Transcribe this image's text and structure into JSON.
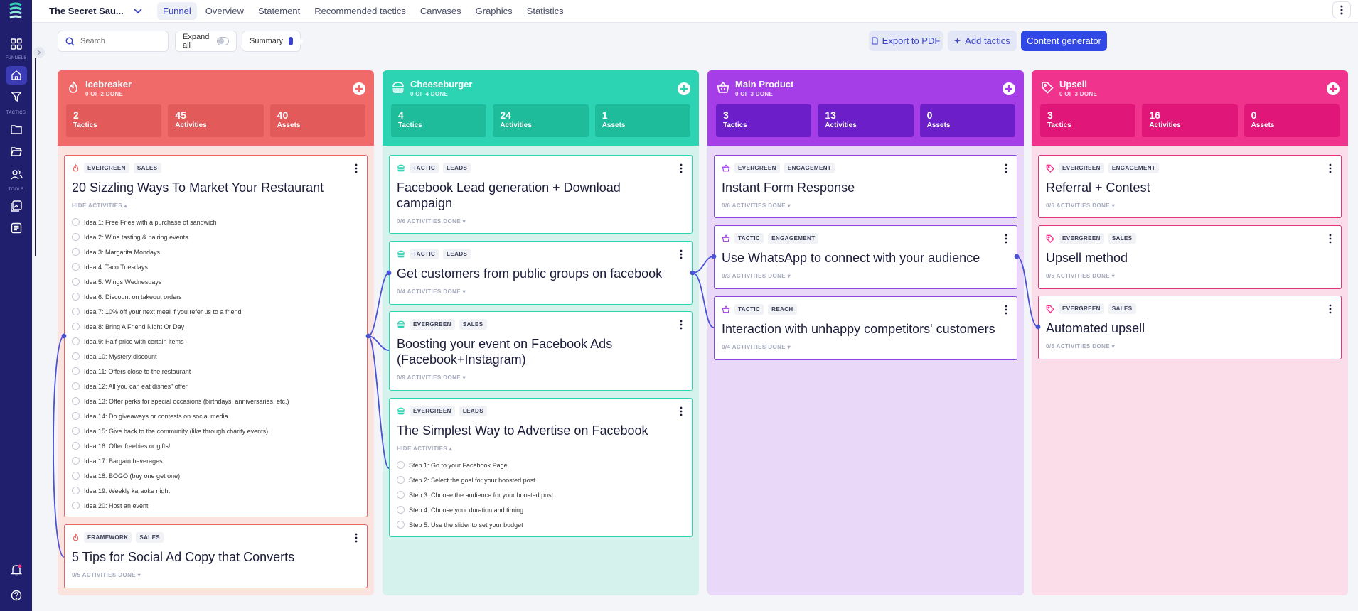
{
  "sidebar": {
    "label_funnels": "FUNNELS",
    "label_tactics": "TACTICS",
    "label_tools": "TOOLS",
    "items": [
      {
        "icon": "grid-icon"
      },
      {
        "icon": "home-icon"
      },
      {
        "icon": "filter-icon"
      },
      {
        "icon": "folder-icon"
      },
      {
        "icon": "folder-open-icon"
      },
      {
        "icon": "users-icon"
      },
      {
        "icon": "image-icon"
      },
      {
        "icon": "document-icon"
      },
      {
        "icon": "bell-icon"
      },
      {
        "icon": "help-icon"
      }
    ]
  },
  "header": {
    "project_name": "The Secret Sau...",
    "tabs": [
      "Funnel",
      "Overview",
      "Statement",
      "Recommended tactics",
      "Canvases",
      "Graphics",
      "Statistics"
    ],
    "active_tab": "Funnel"
  },
  "toolbar": {
    "search_placeholder": "Search",
    "expand_all_label": "Expand all",
    "expand_all_on": false,
    "summary_label": "Summary",
    "summary_on": true,
    "export_label": "Export to PDF",
    "add_tactics_label": "Add tactics",
    "content_generator_label": "Content generator"
  },
  "columns": [
    {
      "title": "Icebreaker",
      "subtitle": "0 OF 2 DONE",
      "color": "#f06a6a",
      "stats": [
        {
          "num": "2",
          "label": "Tactics"
        },
        {
          "num": "45",
          "label": "Activities"
        },
        {
          "num": "40",
          "label": "Assets"
        }
      ],
      "cards": [
        {
          "tags": [
            "EVERGREEN",
            "SALES"
          ],
          "title": "20 Sizzling Ways To Market Your Restaurant",
          "meta": "HIDE ACTIVITIES",
          "activities": [
            "Idea 1: Free Fries with a purchase of sandwich",
            "Idea 2: Wine tasting & pairing events",
            "Idea 3: Margarita Mondays",
            "Idea 4: Taco Tuesdays",
            "Idea 5: Wings Wednesdays",
            "Idea 6: Discount on takeout orders",
            "Idea 7: 10% off your next meal if you refer us to a friend",
            "Idea 8: Bring A Friend Night Or Day",
            "Idea 9: Half-price with certain items",
            "Idea 10: Mystery discount",
            "Idea 11: Offers close to the restaurant",
            "Idea 12: All you can eat dishes\" offer",
            "Idea 13: Offer perks for special occasions (birthdays, anniversaries, etc.)",
            "Idea 14: Do giveaways or contests on social media",
            "Idea 15: Give back to the community (like through charity events)",
            "Idea 16: Offer freebies or gifts!",
            "Idea 17: Bargain beverages",
            "Idea 18: BOGO (buy one get one)",
            "Idea 19: Weekly karaoke night",
            "Idea 20: Host an event"
          ]
        },
        {
          "tags": [
            "FRAMEWORK",
            "SALES"
          ],
          "title": "5 Tips for Social Ad Copy that Converts",
          "meta": "0/5 ACTIVITIES DONE",
          "activities": []
        }
      ]
    },
    {
      "title": "Cheeseburger",
      "subtitle": "0 OF 4 DONE",
      "color": "#2dd4b4",
      "stats": [
        {
          "num": "4",
          "label": "Tactics"
        },
        {
          "num": "24",
          "label": "Activities"
        },
        {
          "num": "1",
          "label": "Assets"
        }
      ],
      "cards": [
        {
          "tags": [
            "TACTIC",
            "LEADS"
          ],
          "title": "Facebook Lead generation + Download campaign",
          "meta": "0/6 ACTIVITIES DONE",
          "activities": []
        },
        {
          "tags": [
            "TACTIC",
            "LEADS"
          ],
          "title": "Get customers from public groups on facebook",
          "meta": "0/4 ACTIVITIES DONE",
          "activities": []
        },
        {
          "tags": [
            "EVERGREEN",
            "SALES"
          ],
          "title": "Boosting your event on Facebook Ads (Facebook+Instagram)",
          "meta": "0/9 ACTIVITIES DONE",
          "activities": []
        },
        {
          "tags": [
            "EVERGREEN",
            "LEADS"
          ],
          "title": "The Simplest Way to Advertise on Facebook",
          "meta": "HIDE ACTIVITIES",
          "activities": [
            "Step 1: Go to your Facebook Page",
            "Step 2: Select the goal for your boosted post",
            "Step 3: Choose the audience for your boosted post",
            "Step 4: Choose your duration and timing",
            "Step 5: Use the slider to set your budget"
          ]
        }
      ]
    },
    {
      "title": "Main Product",
      "subtitle": "0 OF 3 DONE",
      "color": "#a63ee8",
      "stats": [
        {
          "num": "3",
          "label": "Tactics"
        },
        {
          "num": "13",
          "label": "Activities"
        },
        {
          "num": "0",
          "label": "Assets"
        }
      ],
      "cards": [
        {
          "tags": [
            "EVERGREEN",
            "ENGAGEMENT"
          ],
          "title": "Instant Form Response",
          "meta": "0/6 ACTIVITIES DONE",
          "activities": []
        },
        {
          "tags": [
            "TACTIC",
            "ENGAGEMENT"
          ],
          "title": "Use WhatsApp to connect with your audience",
          "meta": "0/3 ACTIVITIES DONE",
          "activities": []
        },
        {
          "tags": [
            "TACTIC",
            "REACH"
          ],
          "title": "Interaction with unhappy competitors' customers",
          "meta": "0/4 ACTIVITIES DONE",
          "activities": []
        }
      ]
    },
    {
      "title": "Upsell",
      "subtitle": "0 OF 3 DONE",
      "color": "#f0338c",
      "stats": [
        {
          "num": "3",
          "label": "Tactics"
        },
        {
          "num": "16",
          "label": "Activities"
        },
        {
          "num": "0",
          "label": "Assets"
        }
      ],
      "cards": [
        {
          "tags": [
            "EVERGREEN",
            "ENGAGEMENT"
          ],
          "title": "Referral + Contest",
          "meta": "0/6 ACTIVITIES DONE",
          "activities": []
        },
        {
          "tags": [
            "EVERGREEN",
            "SALES"
          ],
          "title": "Upsell method",
          "meta": "0/5 ACTIVITIES DONE",
          "activities": []
        },
        {
          "tags": [
            "EVERGREEN",
            "SALES"
          ],
          "title": "Automated upsell",
          "meta": "0/5 ACTIVITIES DONE",
          "activities": []
        }
      ]
    }
  ],
  "colors": {
    "sidebar": "#1f1f6e",
    "primary": "#3147e6",
    "connector": "#4a52d6"
  }
}
